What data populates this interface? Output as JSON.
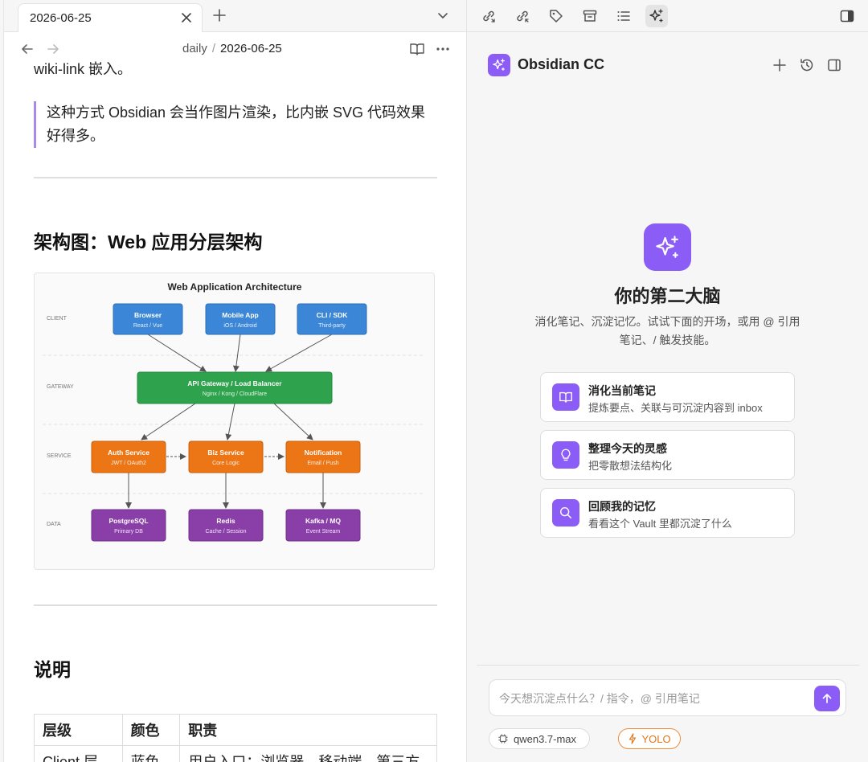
{
  "tabs": {
    "active_title": "2026-06-25"
  },
  "breadcrumb": {
    "folder": "daily",
    "separator": "/",
    "current": "2026-06-25"
  },
  "note": {
    "cut_line": "wiki-link 嵌入。",
    "quote": "这种方式 Obsidian 会当作图片渲染，比内嵌 SVG 代码效果好得多。",
    "heading_architecture": "架构图：Web 应用分层架构",
    "heading_description": "说明",
    "table": {
      "headers": [
        "层级",
        "颜色",
        "职责"
      ],
      "rows": [
        [
          "Client 层",
          "蓝色",
          "用户入口：浏览器、移动端、第三方"
        ]
      ]
    }
  },
  "diagram": {
    "title": "Web Application Architecture",
    "layers": [
      "CLIENT",
      "GATEWAY",
      "SERVICE",
      "DATA"
    ],
    "client": [
      {
        "name": "Browser",
        "sub": "React / Vue"
      },
      {
        "name": "Mobile App",
        "sub": "iOS / Android"
      },
      {
        "name": "CLI / SDK",
        "sub": "Third-party"
      }
    ],
    "gateway": {
      "name": "API Gateway / Load Balancer",
      "sub": "Nginx / Kong / CloudFlare"
    },
    "service": [
      {
        "name": "Auth Service",
        "sub": "JWT / OAuth2"
      },
      {
        "name": "Biz Service",
        "sub": "Core Logic"
      },
      {
        "name": "Notification",
        "sub": "Email / Push"
      }
    ],
    "data": [
      {
        "name": "PostgreSQL",
        "sub": "Primary DB"
      },
      {
        "name": "Redis",
        "sub": "Cache / Session"
      },
      {
        "name": "Kafka / MQ",
        "sub": "Event Stream"
      }
    ],
    "colors": {
      "client": "#3b86d6",
      "gateway": "#2ea24c",
      "service": "#ec7616",
      "data": "#8a3ea8"
    }
  },
  "sidebar_toolbar": {
    "icons": [
      "backlinks-icon",
      "outgoing-links-icon",
      "tag-icon",
      "archive-icon",
      "outline-icon",
      "sparkles-icon"
    ],
    "active": "sparkles-icon"
  },
  "assistant": {
    "title": "Obsidian CC",
    "hero_title": "你的第二大脑",
    "hero_subtitle": "消化笔记、沉淀记忆。试试下面的开场，或用 @ 引用笔记、/ 触发技能。",
    "actions": [
      {
        "title": "消化当前笔记",
        "subtitle": "提炼要点、关联与可沉淀内容到 inbox",
        "icon": "book-icon"
      },
      {
        "title": "整理今天的灵感",
        "subtitle": "把零散想法结构化",
        "icon": "lightbulb-icon"
      },
      {
        "title": "回顾我的记忆",
        "subtitle": "看看这个 Vault 里都沉淀了什么",
        "icon": "search-icon"
      }
    ],
    "input_placeholder": "今天想沉淀点什么？/ 指令，@ 引用笔记",
    "model": "qwen3.7-max",
    "mode": "YOLO",
    "accent_color": "#8b5cf6",
    "yolo_color": "#e0761a"
  }
}
